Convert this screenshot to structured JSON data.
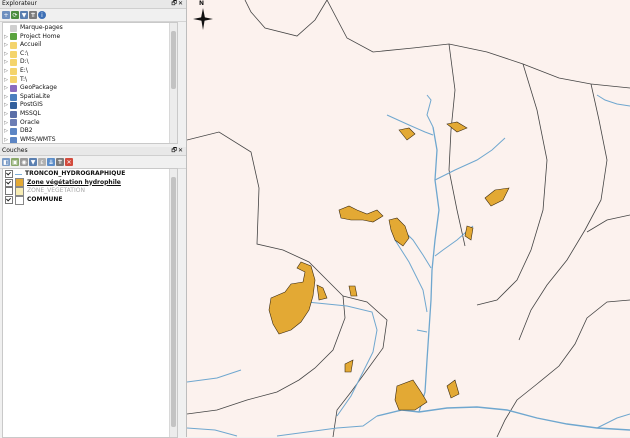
{
  "browser": {
    "title": "Explorateur",
    "controls": "🗗✕",
    "items": [
      {
        "label": "Marque-pages",
        "icon": "star-icon",
        "color": "#cfcfcf"
      },
      {
        "label": "Project Home",
        "icon": "project-home-icon",
        "color": "#5aa33e"
      },
      {
        "label": "Accueil",
        "icon": "folder-icon",
        "color": "#f4d46c"
      },
      {
        "label": "C:\\",
        "icon": "drive-icon",
        "color": "#f4d46c"
      },
      {
        "label": "D:\\",
        "icon": "drive-icon",
        "color": "#f4d46c"
      },
      {
        "label": "E:\\",
        "icon": "drive-icon",
        "color": "#f4d46c"
      },
      {
        "label": "T:\\",
        "icon": "drive-icon",
        "color": "#f4d46c"
      },
      {
        "label": "GeoPackage",
        "icon": "geopackage-icon",
        "color": "#8a6cbe"
      },
      {
        "label": "SpatiaLite",
        "icon": "spatialite-icon",
        "color": "#4b7fbf"
      },
      {
        "label": "PostGIS",
        "icon": "postgis-icon",
        "color": "#33609e"
      },
      {
        "label": "MSSQL",
        "icon": "mssql-icon",
        "color": "#5a6ea8"
      },
      {
        "label": "Oracle",
        "icon": "oracle-icon",
        "color": "#6b7db5"
      },
      {
        "label": "DB2",
        "icon": "db2-icon",
        "color": "#5c85c4"
      },
      {
        "label": "WMS/WMTS",
        "icon": "wms-icon",
        "color": "#5c85c4"
      }
    ]
  },
  "layers": {
    "title": "Couches",
    "controls": "🗗✕",
    "items": [
      {
        "label": "TRONCON_HYDROGRAPHIQUE",
        "checked": true,
        "symbol": "line",
        "color": "#7fb0d8",
        "bold": true,
        "underline": false,
        "muted": false
      },
      {
        "label": "Zone végétation hydrophile",
        "checked": true,
        "symbol": "fill",
        "color": "#e3a934",
        "bold": true,
        "underline": true,
        "muted": false
      },
      {
        "label": "ZONE_VEGETATION",
        "checked": false,
        "symbol": "fill",
        "color": "#f7edb5",
        "bold": false,
        "underline": false,
        "muted": true
      },
      {
        "label": "COMMUNE",
        "checked": true,
        "symbol": "fill",
        "color": "#ffffff",
        "bold": true,
        "underline": false,
        "muted": false
      }
    ]
  },
  "map": {
    "north_label": "N",
    "background": "#fcf2ee",
    "commune_color": "#444444",
    "river_color": "#6fa7cf",
    "vegetation_color": "#e3a934"
  }
}
